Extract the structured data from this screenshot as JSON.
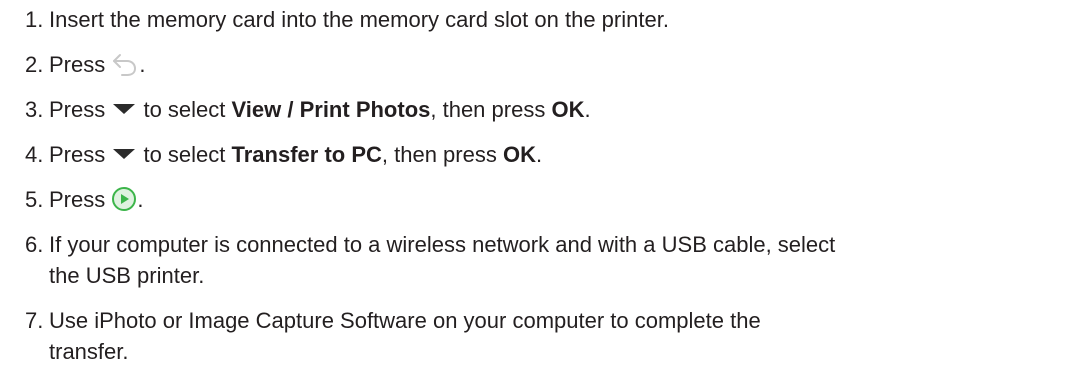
{
  "steps": [
    {
      "num": "1.",
      "text": "Insert the memory card into the memory card slot on the printer."
    },
    {
      "num": "2.",
      "pre": "Press ",
      "icon": "back-arrow-icon",
      "post": "."
    },
    {
      "num": "3.",
      "pre": "Press ",
      "icon": "down-triangle-icon",
      "mid": " to select ",
      "bold1": "View / Print Photos",
      "mid2": ", then press ",
      "bold2": "OK",
      "post": "."
    },
    {
      "num": "4.",
      "pre": "Press ",
      "icon": "down-triangle-icon",
      "mid": " to select ",
      "bold1": "Transfer to PC",
      "mid2": ", then press ",
      "bold2": "OK",
      "post": "."
    },
    {
      "num": "5.",
      "pre": "Press ",
      "icon": "play-circle-icon",
      "post": "."
    },
    {
      "num": "6.",
      "line1": "If your computer is connected to a wireless network and with a USB cable, select",
      "line2": "the USB printer."
    },
    {
      "num": "7.",
      "line1": "Use iPhoto or Image Capture Software on your computer to complete the",
      "line2": "transfer."
    }
  ],
  "colors": {
    "text": "#231f20",
    "icon_gray": "#c8c8c8",
    "triangle": "#2b2b2b",
    "play_green": "#3cb54a",
    "play_bg": "#dff2e0"
  }
}
